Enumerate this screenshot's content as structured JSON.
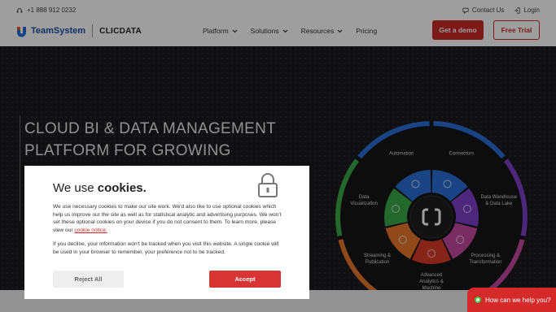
{
  "topbar": {
    "phone": "+1 888 912 0232",
    "contact": "Contact Us",
    "login": "Login"
  },
  "nav": {
    "logo_teamsystem": "TeamSystem",
    "logo_clicdata": "CLICDATA",
    "menu": [
      "Platform",
      "Solutions",
      "Resources",
      "Pricing"
    ],
    "demo_label": "Get a demo",
    "trial_label": "Free Trial"
  },
  "hero": {
    "title": "CLOUD BI & DATA MANAGEMENT PLATFORM FOR GROWING BUSINESSES",
    "wheel": {
      "segments": [
        {
          "label": "Automation",
          "color": "#2b6fd6"
        },
        {
          "label": "Connectors",
          "color": "#2b6fd6"
        },
        {
          "label": "Data Warehouse & Data Lake",
          "color": "#7b3fc7"
        },
        {
          "label": "Processing & Transformation",
          "color": "#c44aa0"
        },
        {
          "label": "Advanced Analytics & Machine Learning",
          "color": "#d93a2b"
        },
        {
          "label": "Streaming & Publication",
          "color": "#e8762b"
        },
        {
          "label": "Data Visualization",
          "color": "#3aa84a"
        }
      ]
    }
  },
  "cookie": {
    "title_prefix": "We use",
    "title_bold": "cookies.",
    "para1": "We use necessary cookies to make our site work. We'd also like to use optional cookies which help us improve our the site as well as for statistical analytic and advertising purposes. We won't set these optional cookies on your device if you do not consent to them. To learn more, please view our",
    "notice_link": "cookie notice.",
    "para2": "If you decline, your information won't be tracked when you visit this website. A single cookie will be used in your browser to remember, your preference not to be tracked.",
    "reject_label": "Reject All",
    "accept_label": "Accept"
  },
  "chat": {
    "label": "How can we help you?"
  },
  "colors": {
    "brand_red": "#c92a2a",
    "hero_bg": "#1b1b1d"
  }
}
